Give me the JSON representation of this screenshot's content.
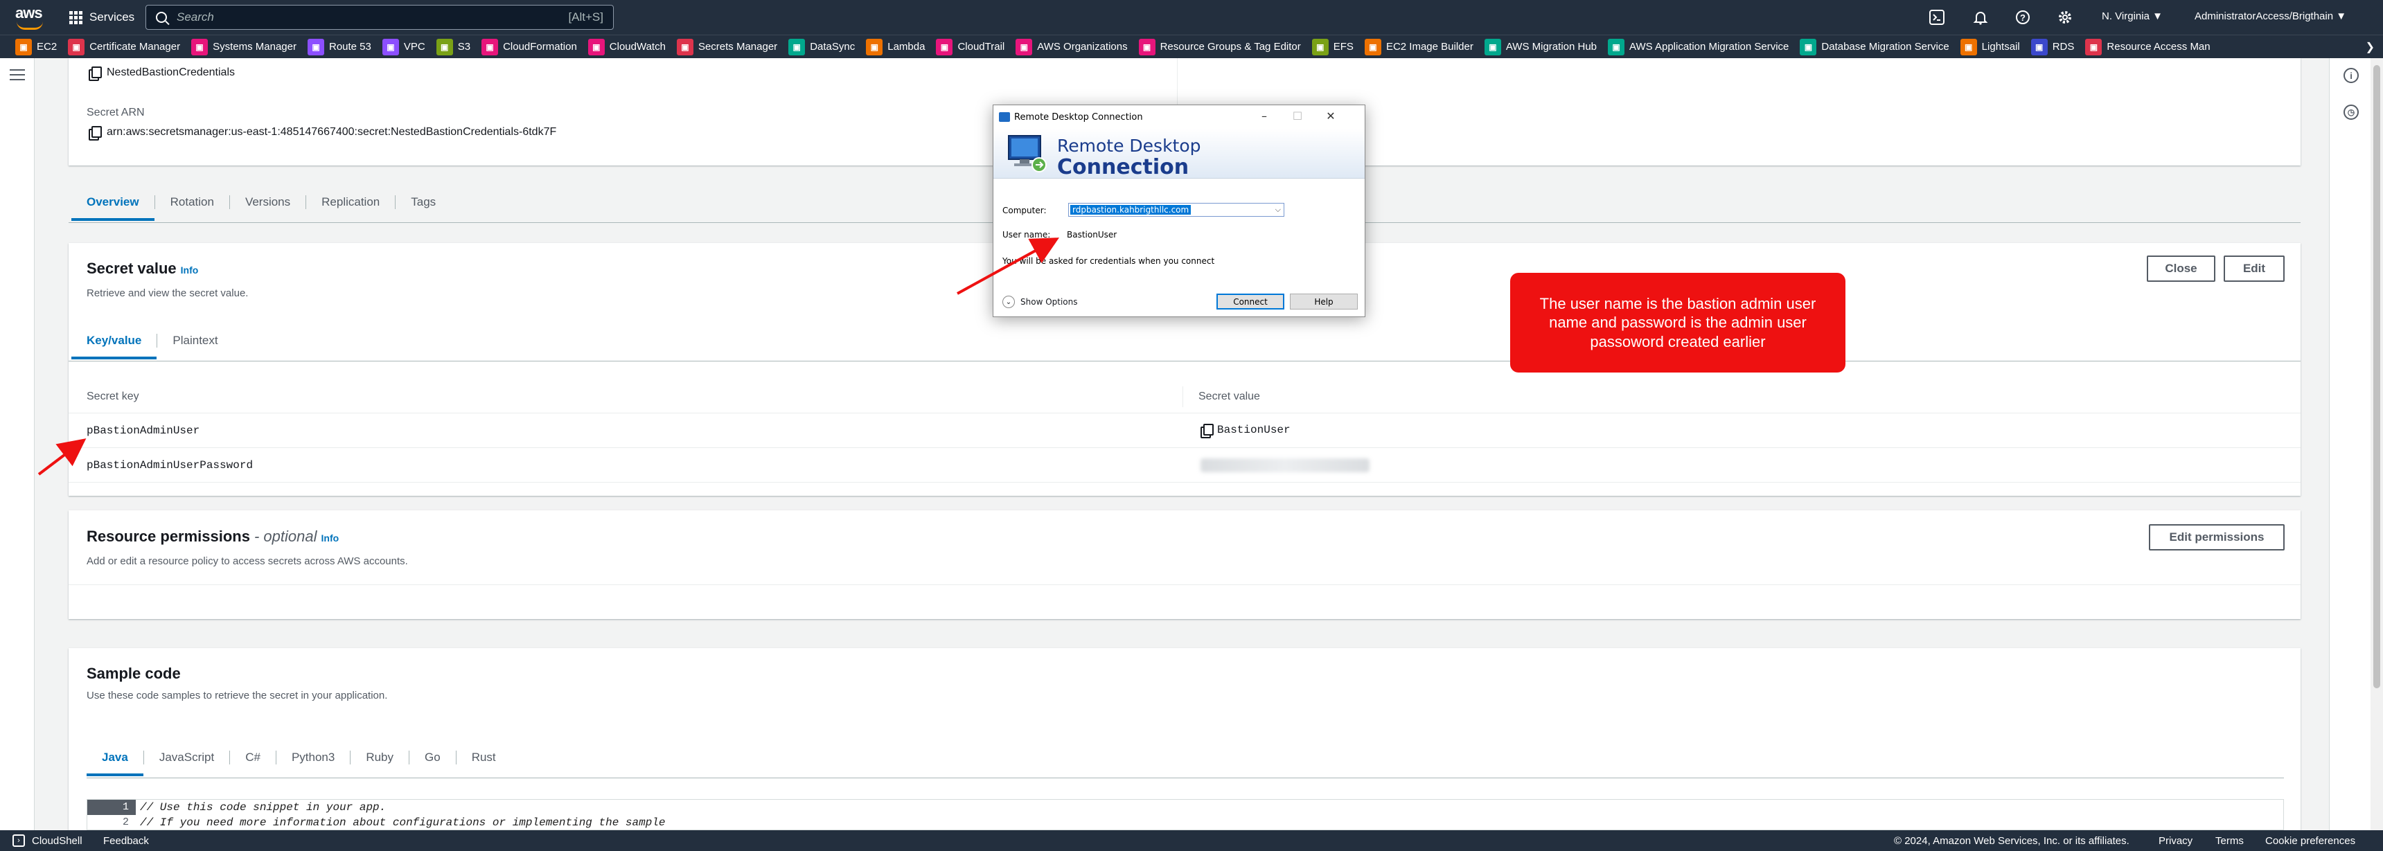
{
  "topnav": {
    "logo_text": "aws",
    "services_label": "Services",
    "search_placeholder": "Search",
    "search_shortcut": "[Alt+S]",
    "region": "N. Virginia ▼",
    "account": "AdministratorAccess/Brigthain ▼"
  },
  "favorites": [
    {
      "label": "EC2",
      "color": "#ed7100",
      "icon": "ec2-icon"
    },
    {
      "label": "Certificate Manager",
      "color": "#dd344c",
      "icon": "certificate-manager-icon"
    },
    {
      "label": "Systems Manager",
      "color": "#e7157b",
      "icon": "systems-manager-icon"
    },
    {
      "label": "Route 53",
      "color": "#8c4fff",
      "icon": "route53-icon"
    },
    {
      "label": "VPC",
      "color": "#8c4fff",
      "icon": "vpc-icon"
    },
    {
      "label": "S3",
      "color": "#7aa116",
      "icon": "s3-icon"
    },
    {
      "label": "CloudFormation",
      "color": "#e7157b",
      "icon": "cloudformation-icon"
    },
    {
      "label": "CloudWatch",
      "color": "#e7157b",
      "icon": "cloudwatch-icon"
    },
    {
      "label": "Secrets Manager",
      "color": "#dd344c",
      "icon": "secrets-manager-icon"
    },
    {
      "label": "DataSync",
      "color": "#01a88d",
      "icon": "datasync-icon"
    },
    {
      "label": "Lambda",
      "color": "#ed7100",
      "icon": "lambda-icon"
    },
    {
      "label": "CloudTrail",
      "color": "#e7157b",
      "icon": "cloudtrail-icon"
    },
    {
      "label": "AWS Organizations",
      "color": "#e7157b",
      "icon": "organizations-icon"
    },
    {
      "label": "Resource Groups & Tag Editor",
      "color": "#e7157b",
      "icon": "resource-groups-icon"
    },
    {
      "label": "EFS",
      "color": "#7aa116",
      "icon": "efs-icon"
    },
    {
      "label": "EC2 Image Builder",
      "color": "#ed7100",
      "icon": "image-builder-icon"
    },
    {
      "label": "AWS Migration Hub",
      "color": "#01a88d",
      "icon": "migration-hub-icon"
    },
    {
      "label": "AWS Application Migration Service",
      "color": "#01a88d",
      "icon": "app-migration-icon"
    },
    {
      "label": "Database Migration Service",
      "color": "#01a88d",
      "icon": "dms-icon"
    },
    {
      "label": "Lightsail",
      "color": "#ed7100",
      "icon": "lightsail-icon"
    },
    {
      "label": "RDS",
      "color": "#3b48cc",
      "icon": "rds-icon"
    },
    {
      "label": "Resource Access Man",
      "color": "#dd344c",
      "icon": "ram-icon"
    }
  ],
  "details": {
    "secret_name": "NestedBastionCredentials",
    "arn_label": "Secret ARN",
    "arn_value": "arn:aws:secretsmanager:us-east-1:485147667400:secret:NestedBastionCredentials-6tdk7F"
  },
  "main_tabs": [
    "Overview",
    "Rotation",
    "Versions",
    "Replication",
    "Tags"
  ],
  "secret_value": {
    "title": "Secret value",
    "info": "Info",
    "description": "Retrieve and view the secret value.",
    "close_label": "Close",
    "edit_label": "Edit",
    "tabs": [
      "Key/value",
      "Plaintext"
    ],
    "col_key": "Secret key",
    "col_value": "Secret value",
    "rows": [
      {
        "key": "pBastionAdminUser",
        "value": "BastionUser"
      },
      {
        "key": "pBastionAdminUserPassword",
        "value": "[blurred]"
      }
    ]
  },
  "resource_permissions": {
    "title": "Resource permissions",
    "optional": "- optional",
    "info": "Info",
    "description": "Add or edit a resource policy to access secrets across AWS accounts.",
    "edit_label": "Edit permissions"
  },
  "sample_code": {
    "title": "Sample code",
    "description": "Use these code samples to retrieve the secret in your application.",
    "tabs": [
      "Java",
      "JavaScript",
      "C#",
      "Python3",
      "Ruby",
      "Go",
      "Rust"
    ],
    "lines": [
      {
        "num": "1",
        "text": "// Use this code snippet in your app."
      },
      {
        "num": "2",
        "text": "// If you need more information about configurations or implementing the sample"
      }
    ]
  },
  "rdp": {
    "window_title": "Remote Desktop Connection",
    "banner_line1": "Remote Desktop",
    "banner_line2": "Connection",
    "computer_label": "Computer:",
    "computer_value": "rdpbastion.kahbrigthllc.com",
    "username_label": "User name:",
    "username_value": "BastionUser",
    "note": "You will be asked for credentials when you connect",
    "show_options": "Show Options",
    "connect": "Connect",
    "help": "Help"
  },
  "annotation": {
    "text": "The user name is the bastion admin user name and password is the admin user passoword created earlier",
    "color": "#ee1111"
  },
  "footer": {
    "cloudshell": "CloudShell",
    "feedback": "Feedback",
    "copyright": "© 2024, Amazon Web Services, Inc. or its affiliates.",
    "privacy": "Privacy",
    "terms": "Terms",
    "cookies": "Cookie preferences"
  },
  "colors": {
    "nav": "#232f3e",
    "link": "#0073bb",
    "accent": "#ff9900"
  }
}
